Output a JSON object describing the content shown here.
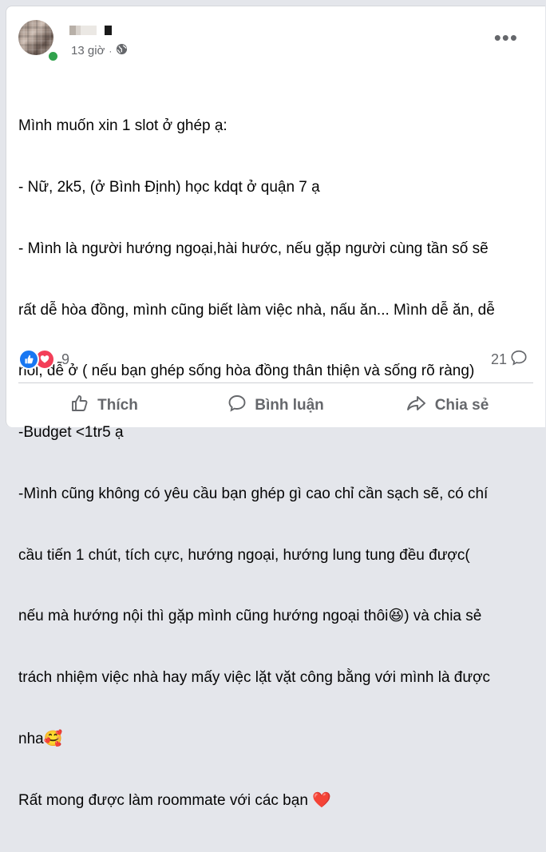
{
  "author": {
    "name_redacted": true,
    "time": "13 giờ",
    "separator": "·",
    "privacy_icon": "globe-icon"
  },
  "post": {
    "lines": [
      "Mình muốn xin 1 slot ở ghép ạ:",
      "- Nữ, 2k5, (ở Bình Định) học kdqt ở quận 7 ạ",
      "- Mình là người hướng ngoại,hài hước, nếu gặp người cùng tần số sẽ",
      "rất dễ hòa đồng, mình cũng biết làm việc nhà, nấu ăn... Mình dễ ăn, dễ",
      "nói, dễ ở ( nếu bạn ghép sống hòa đồng thân thiện và sống rõ ràng)",
      "-Budget <1tr5 ạ",
      "-Mình cũng không có yêu cầu bạn ghép gì cao chỉ cần sạch sẽ, có chí",
      "cầu tiến 1 chút, tích cực, hướng ngoại, hướng lung tung đều được(",
      "nếu mà hướng nội thì gặp mình cũng hướng ngoại thôi😆) và chia sẻ",
      "trách nhiệm việc nhà hay mấy việc lặt vặt công bằng với mình là được",
      "nha🥰",
      "Rất mong được làm roommate với các bạn ❤️"
    ]
  },
  "stats": {
    "reactions": [
      "like",
      "love"
    ],
    "reaction_count": "9",
    "comment_count": "21"
  },
  "actions": {
    "like": "Thích",
    "comment": "Bình luận",
    "share": "Chia sẻ"
  },
  "colors": {
    "like_blue": "#1877f2",
    "love_red": "#f33e58",
    "secondary_text": "#65676b",
    "online_green": "#31a24c"
  }
}
